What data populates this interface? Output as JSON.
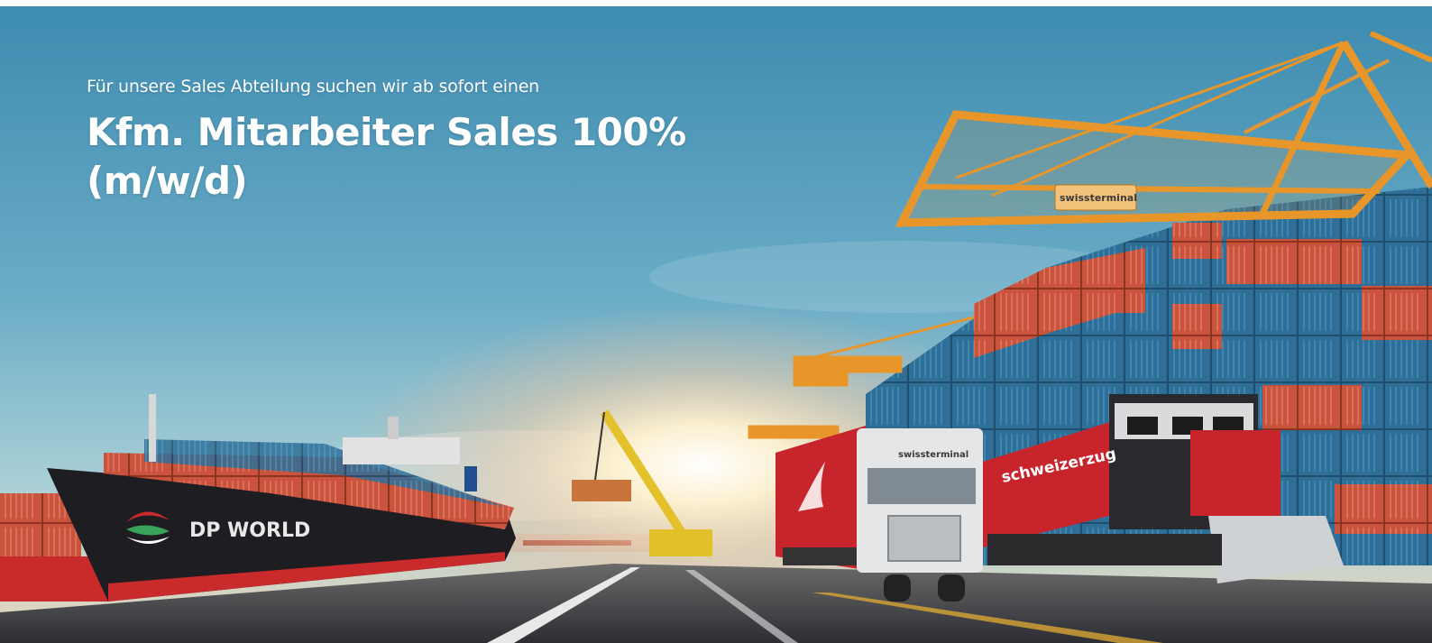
{
  "intro_text": "Für unsere Sales Abteilung suchen wir ab sofort einen",
  "job_title": {
    "line1": "Kfm. Mitarbeiter Sales 100%",
    "line2": "(m/w/d)"
  },
  "scene": {
    "ship_brand": "DP WORLD",
    "truck_brand": "swissterminal",
    "crane_brand": "swissterminal",
    "train_brand": "schweizerzug"
  },
  "colors": {
    "sky_top": "#2e7fa3",
    "sky_mid": "#6fb1c9",
    "sun": "#fff4d6",
    "crane": "#e8962a",
    "container_blue": "#2f6e97",
    "container_red": "#c9533d",
    "train_red": "#c8242b",
    "road": "#3c3f44"
  }
}
